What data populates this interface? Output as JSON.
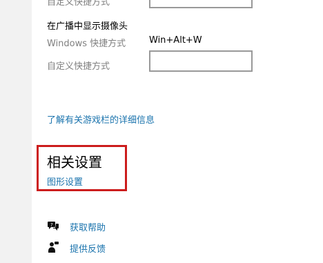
{
  "shortcuts": {
    "rows": [
      {
        "label": "自定义快捷方式",
        "value": ""
      },
      {
        "label": "Windows 快捷方式",
        "value": "Win+Alt+W"
      },
      {
        "label": "自定义快捷方式",
        "value": ""
      }
    ],
    "section_label": "在广播中显示摄像头"
  },
  "learn_more_link": "了解有关游戏栏的详细信息",
  "related_settings": {
    "title": "相关设置",
    "graphics_link": "图形设置"
  },
  "help": {
    "get_help": "获取帮助",
    "feedback": "提供反馈"
  },
  "colors": {
    "link": "#1a73ad",
    "highlight": "#cc1c1c"
  },
  "icons": {
    "get_help": "help-chat-icon",
    "feedback": "feedback-person-icon"
  }
}
